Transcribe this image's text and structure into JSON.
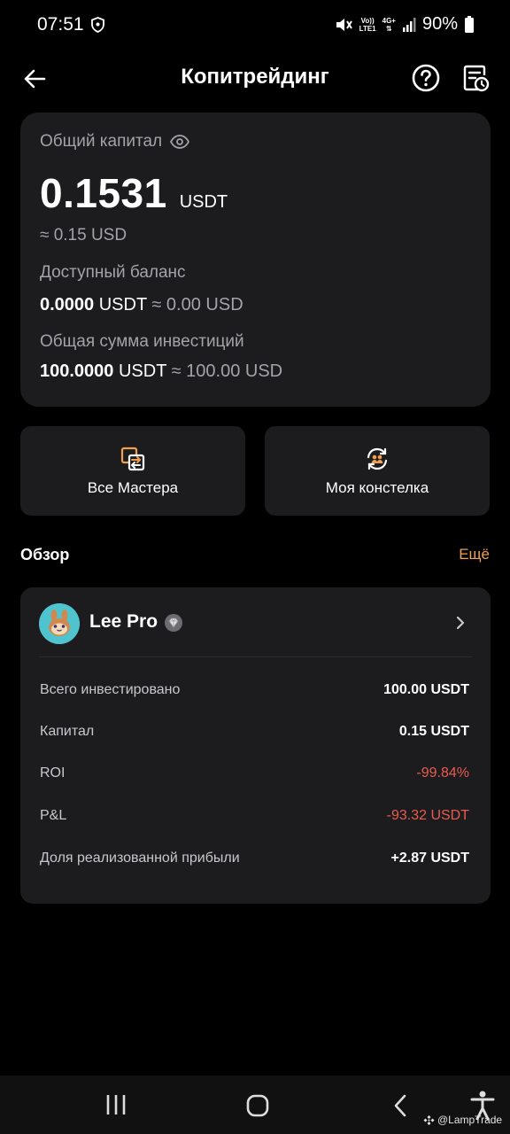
{
  "status_bar": {
    "time": "07:51",
    "net_line1": "Vo))",
    "net_line2": "LTE1",
    "net_4g": "4G+",
    "battery": "90%"
  },
  "header": {
    "title": "Копитрейдинг",
    "icons": [
      "back-arrow-icon",
      "help-icon",
      "history-icon"
    ]
  },
  "capital": {
    "label": "Общий капитал",
    "value": "0.1531",
    "unit": "USDT",
    "approx": "≈ 0.15 USD",
    "available_label": "Доступный баланс",
    "available_value": "0.0000",
    "available_unit": "USDT",
    "available_approx": "≈ 0.00 USD",
    "invest_label": "Общая сумма инвестиций",
    "invest_value": "100.0000",
    "invest_unit": "USDT",
    "invest_approx": "≈ 100.00 USD"
  },
  "actions": [
    {
      "label": "Все Мастера",
      "icon": "masters-icon"
    },
    {
      "label": "Моя констелка",
      "icon": "copy-deal-icon"
    }
  ],
  "overview": {
    "title": "Обзор",
    "more": "Ещё"
  },
  "trader": {
    "name": "Lee Pro",
    "stats": [
      {
        "label": "Всего инвестировано",
        "value": "100.00 USDT"
      },
      {
        "label": "Капитал",
        "value": "0.15 USDT"
      },
      {
        "label": "ROI",
        "value": "-99.84%"
      },
      {
        "label": "P&L",
        "value": "-93.32 USDT"
      },
      {
        "label": "Доля реализованной прибыли",
        "value": "+2.87 USDT"
      }
    ]
  },
  "watermark": "@LampTrade",
  "colors": {
    "background": "#000000",
    "card": "#1c1c1e",
    "accent": "#f0a050",
    "negative": "#ea5b4f",
    "muted_text": "#a3a3a8"
  }
}
